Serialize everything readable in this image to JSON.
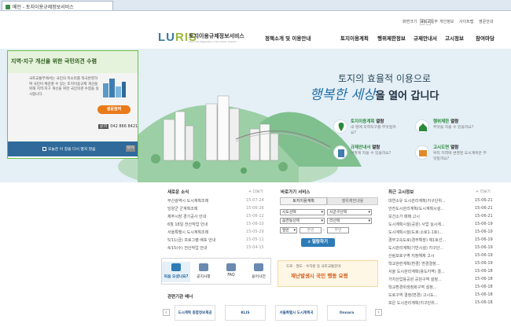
{
  "browser": {
    "tab_title": "메인 - 토지이용규제정보서비스"
  },
  "util_links": [
    "국토교통부",
    "개인정보",
    "사이트맵",
    "영문안내"
  ],
  "font_sizes": {
    "label": "화면크기",
    "plus": "+",
    "minus": "-"
  },
  "logo": {
    "text": "LURIS",
    "kr": "토지이용규제정보서비스",
    "en": "Land Use Regulation Information System"
  },
  "gnb": [
    "정책소개 및 이용안내",
    "토지이용계획",
    "행위제한정보",
    "규제안내서",
    "고시정보",
    "참여마당"
  ],
  "popup": {
    "title": "지역·지구 개선을 위한 국민의견 수렴",
    "body": "국토교통부에서는 국민의 목소리를 적극반영하여 국민이 체감할 수 있는 토지이용규제 개선을 위해 지역·지구 개선을 위한 국민의견 수렴을 실시합니다.",
    "button": "설문참여",
    "phone_label": "문의",
    "phone": "042 866 8421",
    "checkbox_label": "오늘은 이 창을 다시 열지 않음",
    "close": "닫기"
  },
  "hero": {
    "title": "토지의 효율적 이용으로",
    "sub_script": "행복한 세상",
    "sub_bold": "을 열어 갑니다"
  },
  "services": [
    {
      "title_em": "토지이용계획",
      "title": " 열람",
      "desc": "내 땅에 지역지구를 무엇일까요?",
      "icon": "map-pin-icon"
    },
    {
      "title_em": "행위제한",
      "title": " 열람",
      "desc": "무엇을 지을 수 있을까요?",
      "icon": "house-icon"
    },
    {
      "title_em": "규제안내서",
      "title": " 열람",
      "desc": "어떻게 지을 수 있을까요?",
      "icon": "document-icon"
    },
    {
      "title_em": "고시도면",
      "title": " 열람",
      "desc": "우리 지역에 변경된 도시계획은 무엇일까요?",
      "icon": "map-icon"
    }
  ],
  "news": {
    "title": "새로운 소식",
    "more": "+ 더보기",
    "items": [
      {
        "text": "부산광역시 도시계획조례",
        "date": "15-07-24"
      },
      {
        "text": "당양군 군계획조례",
        "date": "15-06-26"
      },
      {
        "text": "제주시장 경기공사 안내",
        "date": "15-06-12"
      },
      {
        "text": "6월 18일 전산작업 안내",
        "date": "15-06-10"
      },
      {
        "text": "서울특별시 도시계획조례",
        "date": "15-05-29"
      },
      {
        "text": "5/11(금) 프로그램 배포 안내",
        "date": "15-05-11"
      },
      {
        "text": "4/15(수) 전산작업 안내",
        "date": "15-04-15"
      }
    ]
  },
  "quick_search": {
    "title": "바로가기 서비스",
    "tab1": "토지이용계획",
    "tab2": "행위제한내용",
    "sido": "시도선택",
    "sigungu": "시군구선택",
    "dong": "읍면동선택",
    "ri": "리선택",
    "type": "일반",
    "bon": "본번",
    "bu": "부번",
    "button": "열람하기"
  },
  "ad": {
    "line1": "도로 · 철도 · 수자원 등 국토교통분야",
    "line2": "재난발생시 국민 행동 요령"
  },
  "quick_menu": [
    "처음 오셨나요?",
    "공지사항",
    "FAQ",
    "용어사전"
  ],
  "notices": {
    "title": "최근 고시정보",
    "more": "+ 더보기",
    "items": [
      {
        "text": "대연소유 도시관리계획(지구단위...",
        "date": "15-06-21"
      },
      {
        "text": "안전도시관리계획(도시계획시설...",
        "date": "15-06-21"
      },
      {
        "text": "보건소가 매매 고시",
        "date": "15-06-21"
      },
      {
        "text": "도시계획시설(공원) 사업 실시계...",
        "date": "15-06-19"
      },
      {
        "text": "도시계획시설(도로:소로1-1호)...",
        "date": "15-06-19"
      },
      {
        "text": "경부고속도로(경부확장) 제1호선...",
        "date": "15-06-19"
      },
      {
        "text": "도시관리계획(기반시설) 지구단...",
        "date": "15-06-19"
      },
      {
        "text": "산림보호구역 지정해제 고시",
        "date": "15-06-19"
      },
      {
        "text": "학교관련계획(변경) 변경결정...",
        "date": "15-06-19"
      },
      {
        "text": "서울 도시관리계획(용도지역) 결...",
        "date": "15-06-18"
      },
      {
        "text": "가치산업용공원 공원구역 설정...",
        "date": "15-06-18"
      },
      {
        "text": "학교환경위생정화구역 설정...",
        "date": "15-06-18"
      },
      {
        "text": "도로구역 결정(변경) 고시도...",
        "date": "15-06-18"
      },
      {
        "text": "포은 도시관리계획(지구단위...",
        "date": "15-06-18"
      }
    ]
  },
  "related": {
    "title": "관련기관 배너",
    "banners": [
      "도시계획 종합정보제공",
      "KLIS",
      "서울특별시 도시계획국",
      "Onnara"
    ]
  },
  "colors": {
    "accent": "#2e7bb6",
    "green": "#6ec04a",
    "orange": "#e97a1a",
    "hero_bg": "#e4eff6"
  }
}
